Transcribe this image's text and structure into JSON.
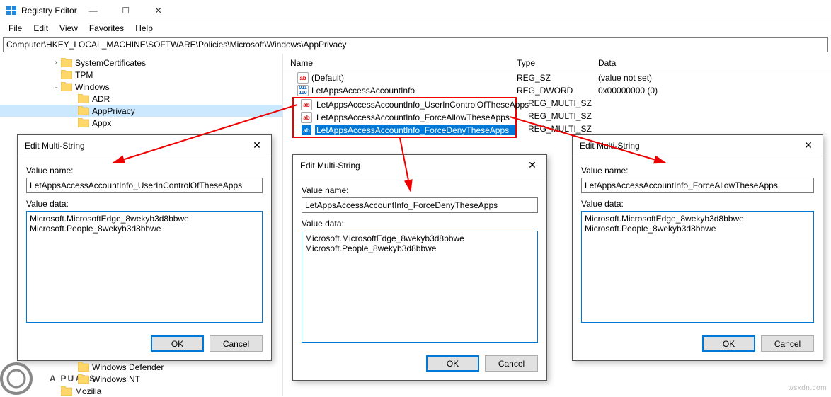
{
  "window": {
    "title": "Registry Editor",
    "controls": {
      "min": "—",
      "max": "☐",
      "close": "✕"
    }
  },
  "menu": {
    "file": "File",
    "edit": "Edit",
    "view": "View",
    "favorites": "Favorites",
    "help": "Help"
  },
  "address": "Computer\\HKEY_LOCAL_MACHINE\\SOFTWARE\\Policies\\Microsoft\\Windows\\AppPrivacy",
  "tree": {
    "items": [
      {
        "indent": 72,
        "expander": ">",
        "label": "SystemCertificates"
      },
      {
        "indent": 72,
        "expander": "",
        "label": "TPM"
      },
      {
        "indent": 72,
        "expander": "v",
        "label": "Windows"
      },
      {
        "indent": 96,
        "expander": "",
        "label": "ADR"
      },
      {
        "indent": 96,
        "expander": "",
        "label": "AppPrivacy",
        "selected": true
      },
      {
        "indent": 96,
        "expander": "",
        "label": "Appx"
      },
      {
        "indent": 96,
        "expander": "",
        "label": "Windows Defender"
      },
      {
        "indent": 96,
        "expander": "",
        "label": "Windows NT"
      },
      {
        "indent": 72,
        "expander": "",
        "label": "Mozilla"
      }
    ]
  },
  "list": {
    "headers": {
      "name": "Name",
      "type": "Type",
      "data": "Data"
    },
    "rows": [
      {
        "icon": "ab",
        "name": "(Default)",
        "type": "REG_SZ",
        "data": "(value not set)"
      },
      {
        "icon": "num",
        "name": "LetAppsAccessAccountInfo",
        "type": "REG_DWORD",
        "data": "0x00000000 (0)"
      }
    ],
    "highlight": [
      {
        "icon": "ab",
        "name": "LetAppsAccessAccountInfo_UserInControlOfTheseApps",
        "type": "REG_MULTI_SZ",
        "data": ""
      },
      {
        "icon": "ab",
        "name": "LetAppsAccessAccountInfo_ForceAllowTheseApps",
        "type": "REG_MULTI_SZ",
        "data": ""
      },
      {
        "icon": "ab",
        "name": "LetAppsAccessAccountInfo_ForceDenyTheseApps",
        "type": "REG_MULTI_SZ",
        "data": "",
        "selected": true
      }
    ]
  },
  "dialog": {
    "title": "Edit Multi-String",
    "value_name_label": "Value name:",
    "value_data_label": "Value data:",
    "ok": "OK",
    "cancel": "Cancel",
    "a_name": "LetAppsAccessAccountInfo_UserInControlOfTheseApps",
    "b_name": "LetAppsAccessAccountInfo_ForceDenyTheseApps",
    "c_name": "LetAppsAccessAccountInfo_ForceAllowTheseApps",
    "textarea_val": "Microsoft.MicrosoftEdge_8wekyb3d8bbwe\nMicrosoft.People_8wekyb3d8bbwe"
  },
  "watermark": "wsxdn.com",
  "logo": "A  PUALS"
}
